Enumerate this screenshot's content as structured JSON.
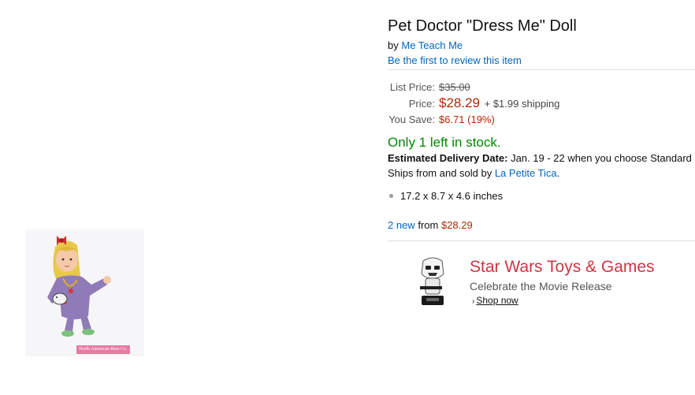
{
  "product": {
    "title": "Pet Doctor \"Dress Me\" Doll",
    "by_prefix": "by",
    "brand": "Me Teach Me",
    "review_link": "Be the first to review this item",
    "image_caption": "North American Bear Co."
  },
  "pricing": {
    "list_label": "List Price:",
    "list_price": "$35.00",
    "price_label": "Price:",
    "price": "$28.29",
    "shipping": "+ $1.99 shipping",
    "save_label": "You Save:",
    "save_value": "$6.71 (19%)"
  },
  "availability": {
    "stock": "Only 1 left in stock.",
    "delivery_label": "Estimated Delivery Date:",
    "delivery_text": "Jan. 19 - 22 when you choose Standard",
    "ships_prefix": "Ships from and sold by",
    "seller": "La Petite Tica",
    "ships_suffix": "."
  },
  "features": [
    "17.2 x 8.7 x 4.6 inches"
  ],
  "offers": {
    "new_link": "2 new",
    "from_text": "from",
    "from_price": "$28.29"
  },
  "ad": {
    "title": "Star Wars Toys & Games",
    "subtitle": "Celebrate the Movie Release",
    "link": "Shop now"
  },
  "colors": {
    "price_red": "#b12704",
    "stock_green": "#008a00",
    "link_blue": "#0066c0",
    "ad_red": "#cf3442"
  }
}
